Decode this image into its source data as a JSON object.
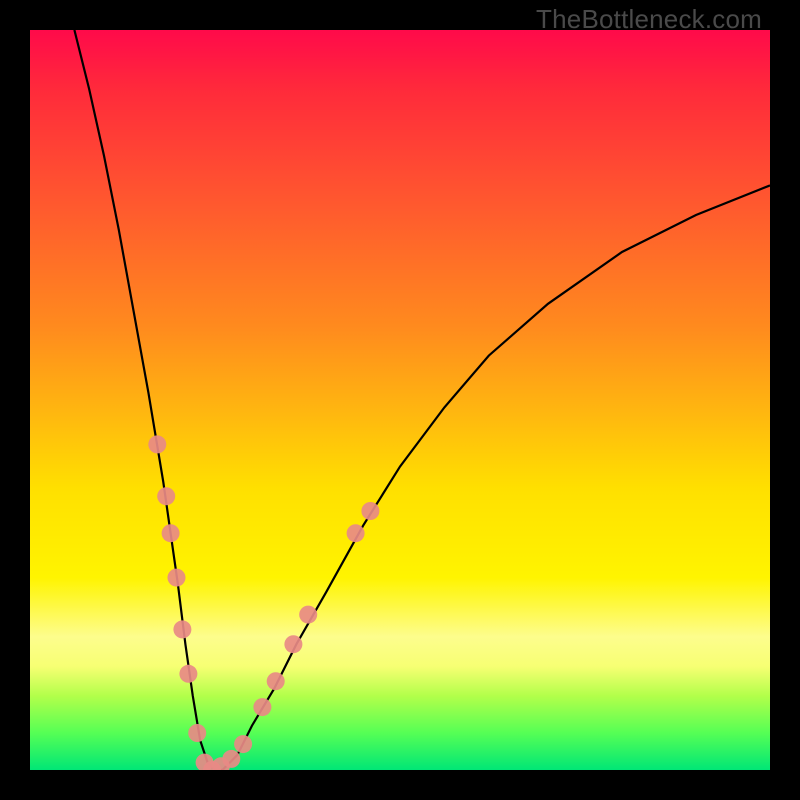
{
  "watermark": "TheBottleneck.com",
  "colors": {
    "frame_bg": "#000000",
    "curve_stroke": "#000000",
    "marker_fill": "#e88a85",
    "marker_stroke": "#e88a85"
  },
  "chart_data": {
    "type": "line",
    "title": "",
    "xlabel": "",
    "ylabel": "",
    "xlim": [
      0,
      100
    ],
    "ylim": [
      0,
      100
    ],
    "grid": false,
    "legend": false,
    "annotations": [
      "TheBottleneck.com"
    ],
    "series": [
      {
        "name": "bottleneck-curve",
        "x": [
          6,
          8,
          10,
          12,
          14,
          16,
          18,
          20,
          21,
          22,
          23,
          24,
          25,
          26,
          28,
          30,
          33,
          36,
          40,
          45,
          50,
          56,
          62,
          70,
          80,
          90,
          100
        ],
        "y": [
          100,
          92,
          83,
          73,
          62,
          51,
          39,
          25,
          17,
          10,
          4,
          1,
          0,
          0,
          2,
          6,
          11,
          17,
          24,
          33,
          41,
          49,
          56,
          63,
          70,
          75,
          79
        ]
      }
    ],
    "markers": [
      {
        "x": 17.2,
        "y": 44
      },
      {
        "x": 18.4,
        "y": 37
      },
      {
        "x": 19.0,
        "y": 32
      },
      {
        "x": 19.8,
        "y": 26
      },
      {
        "x": 20.6,
        "y": 19
      },
      {
        "x": 21.4,
        "y": 13
      },
      {
        "x": 22.6,
        "y": 5
      },
      {
        "x": 23.6,
        "y": 1
      },
      {
        "x": 24.6,
        "y": 0
      },
      {
        "x": 25.8,
        "y": 0.5
      },
      {
        "x": 27.2,
        "y": 1.5
      },
      {
        "x": 28.8,
        "y": 3.5
      },
      {
        "x": 31.4,
        "y": 8.5
      },
      {
        "x": 33.2,
        "y": 12
      },
      {
        "x": 35.6,
        "y": 17
      },
      {
        "x": 37.6,
        "y": 21
      },
      {
        "x": 44.0,
        "y": 32
      },
      {
        "x": 46.0,
        "y": 35
      }
    ]
  }
}
